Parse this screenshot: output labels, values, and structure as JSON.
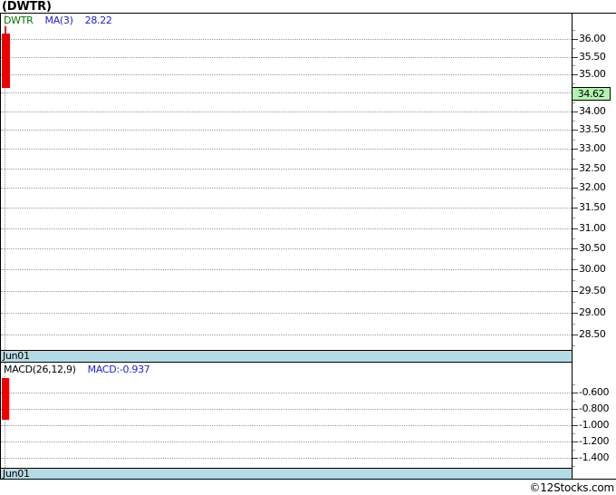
{
  "header": {
    "title": "(DWTR)"
  },
  "footer": {
    "credit": "©12Stocks.com"
  },
  "colors": {
    "candle_down": "#ee0000",
    "macd_bar": "#ee0000",
    "date_band": "#b2dbe5",
    "price_badge_bg": "#b0f4b0",
    "symbol_text": "#007700",
    "indicator_text": "#2222cc",
    "grid": "#999999",
    "border": "#000000"
  },
  "price_panel": {
    "legend": {
      "symbol": "DWTR",
      "ma_label": "MA(3)",
      "ma_value": "28.22"
    },
    "current_price": "34.62",
    "date_label": "Jun01"
  },
  "macd_panel": {
    "legend": {
      "label": "MACD(26,12,9)",
      "value_label": "MACD:-0.937"
    },
    "date_label": "Jun01"
  },
  "chart_data": [
    {
      "type": "candlestick",
      "title": "(DWTR) daily price",
      "x": [
        "Jun01"
      ],
      "series": [
        {
          "name": "DWTR",
          "ohlc": [
            {
              "open": 36.15,
              "high": 36.35,
              "low": 34.62,
              "close": 34.62,
              "direction": "down"
            }
          ]
        }
      ],
      "overlays": [
        {
          "name": "MA(3)",
          "last_value": 28.22
        }
      ],
      "last_price": 34.62,
      "y_scale": "log",
      "ylim": [
        28.2,
        36.7
      ],
      "yticks": [
        36.0,
        35.5,
        35.0,
        34.5,
        34.0,
        33.5,
        33.0,
        32.5,
        32.0,
        31.5,
        31.0,
        30.5,
        30.0,
        29.5,
        29.0,
        28.5
      ],
      "ytick_labels": [
        "36.00",
        "35.50",
        "35.00",
        "34.00",
        "33.50",
        "33.00",
        "32.50",
        "32.00",
        "31.50",
        "31.00",
        "30.50",
        "30.00",
        "29.50",
        "29.00",
        "28.50"
      ],
      "grid": true,
      "axis_position": "right",
      "legend_position": "top-left"
    },
    {
      "type": "bar",
      "title": "MACD(26,12,9)",
      "x": [
        "Jun01"
      ],
      "values": [
        -0.937
      ],
      "ylim": [
        -1.51,
        -0.22
      ],
      "yticks": [
        -0.6,
        -0.8,
        -1.0,
        -1.2,
        -1.4
      ],
      "ytick_labels": [
        "-0.600",
        "-0.800",
        "-1.000",
        "-1.200",
        "-1.400"
      ],
      "grid": true,
      "axis_position": "right"
    }
  ]
}
